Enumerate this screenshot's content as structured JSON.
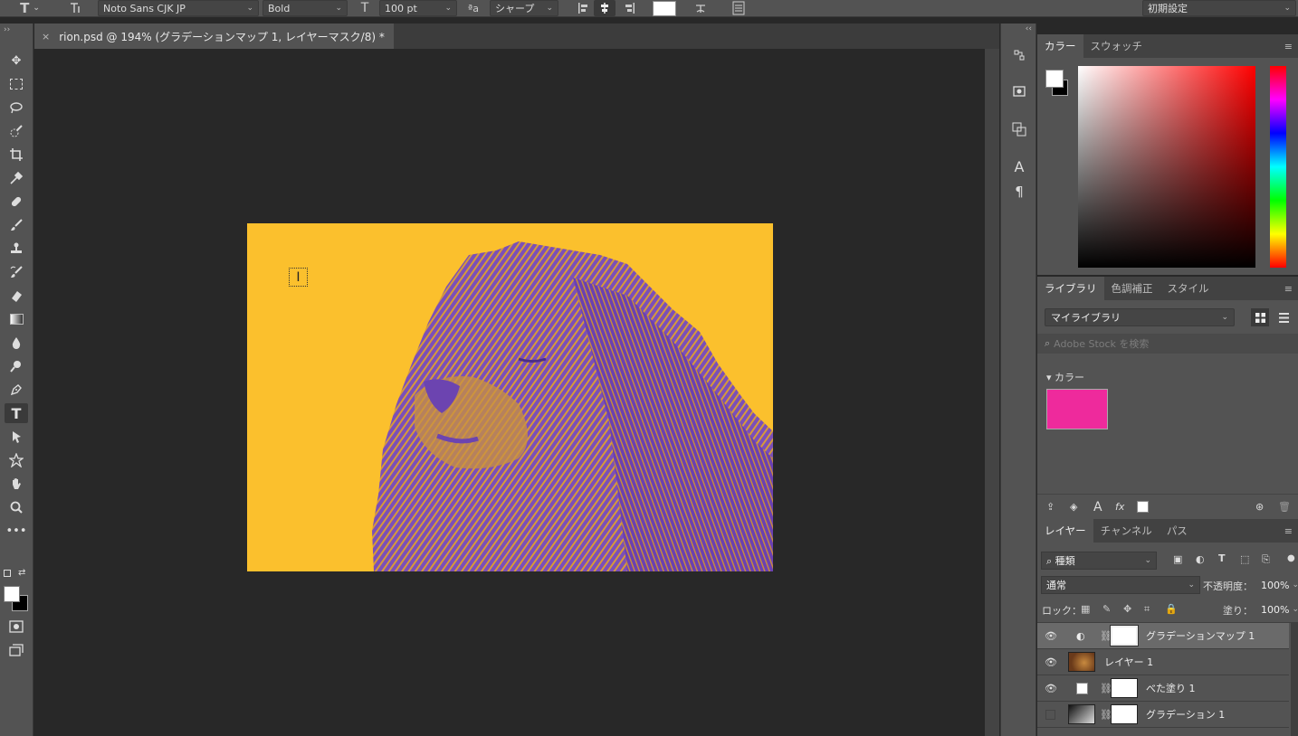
{
  "options_bar": {
    "tool_icon": "type-tool-icon",
    "font_family": "Noto Sans CJK JP",
    "font_style": "Bold",
    "font_size": "100 pt",
    "aa_label": "ªa",
    "antialias": "シャープ",
    "workspace": "初期設定"
  },
  "document_tab": {
    "title": "rion.psd @ 194% (グラデーションマップ 1, レイヤーマスク/8) *",
    "close": "×"
  },
  "color_panel": {
    "tabs": [
      "カラー",
      "スウォッチ"
    ],
    "foreground": "#ffffff",
    "background": "#000000"
  },
  "library_panel": {
    "tabs": [
      "ライブラリ",
      "色調補正",
      "スタイル"
    ],
    "library_name": "マイライブラリ",
    "search_placeholder": "Adobe Stock を検索",
    "section": "カラー",
    "swatch_color": "#ee2a9c"
  },
  "layers_panel": {
    "tabs": [
      "レイヤー",
      "チャンネル",
      "パス"
    ],
    "filter": "種類",
    "blend_mode": "通常",
    "opacity_label": "不透明度：",
    "opacity": "100%",
    "lock_label": "ロック：",
    "fill_label": "塗り：",
    "fill": "100%",
    "layers": [
      {
        "name": "グラデーションマップ 1",
        "visible": true,
        "selected": true
      },
      {
        "name": "レイヤー 1",
        "visible": true,
        "selected": false
      },
      {
        "name": "べた塗り 1",
        "visible": true,
        "selected": false
      },
      {
        "name": "グラデーション 1",
        "visible": false,
        "selected": false
      }
    ]
  },
  "canvas": {
    "background_color": "#fbc02d",
    "duotone_dark": "#6b45b8",
    "duotone_light": "#fbc02d"
  }
}
